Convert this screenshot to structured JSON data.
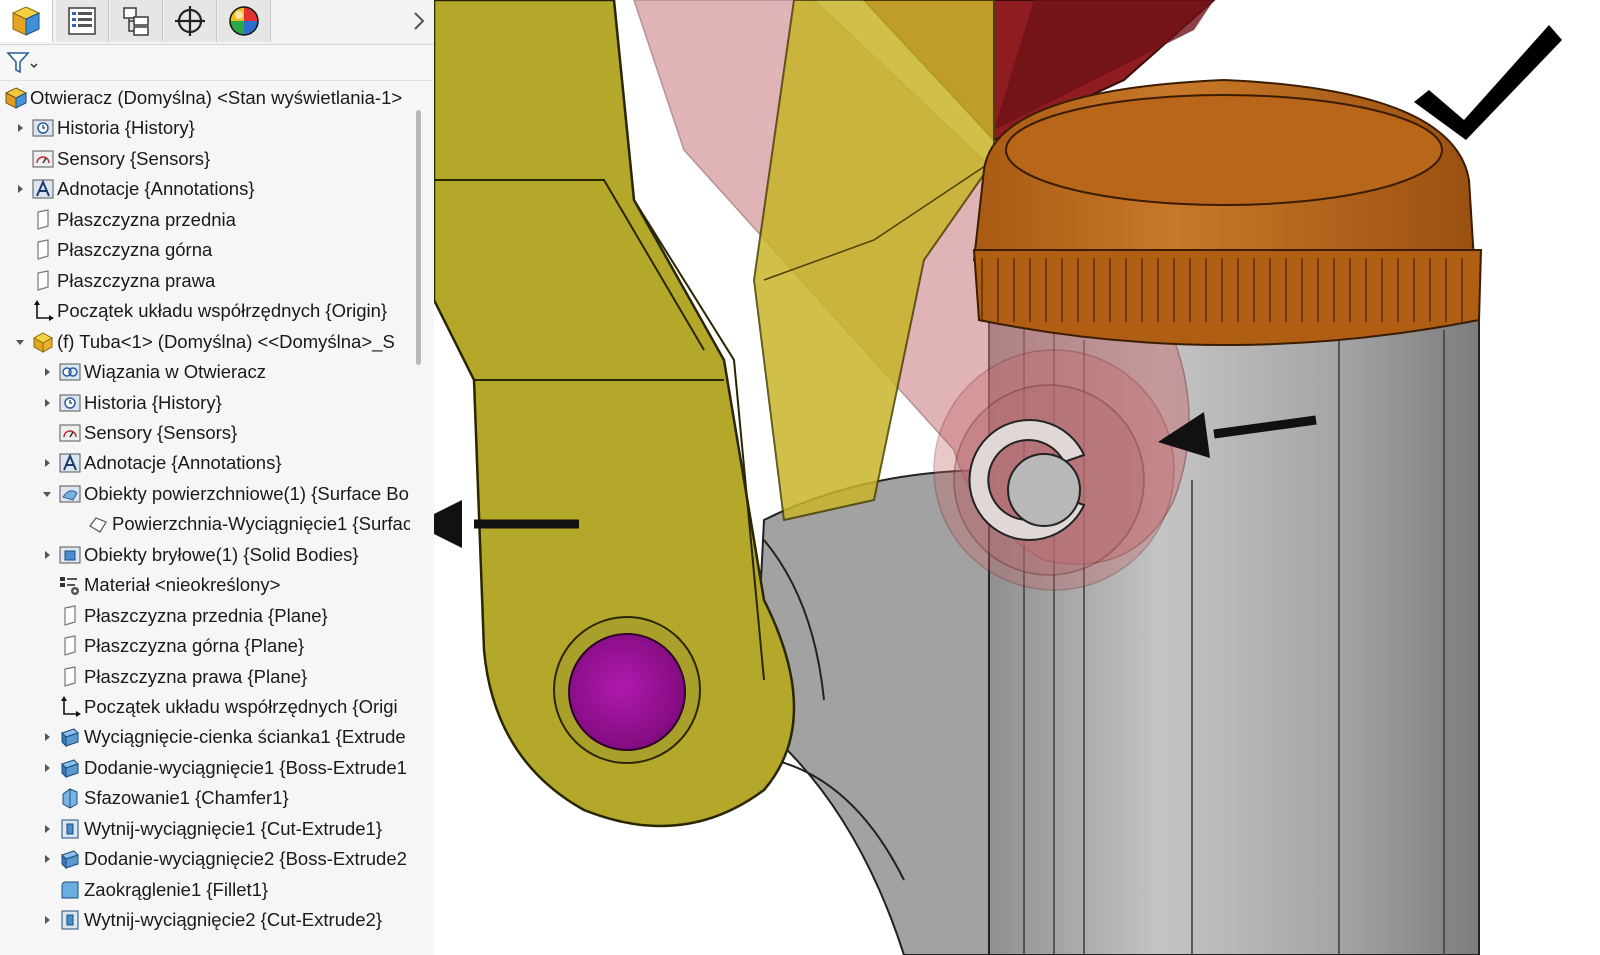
{
  "panel": {
    "tabs": [
      {
        "icon": "part-cube-icon"
      },
      {
        "icon": "property-manager-icon"
      },
      {
        "icon": "configuration-manager-icon"
      },
      {
        "icon": "dimxpert-crosshair-icon"
      },
      {
        "icon": "display-manager-sphere-icon"
      }
    ],
    "filter_icon": "filter-icon"
  },
  "tree": [
    {
      "label": "Otwieracz (Domyślna) <Stan wyświetlania-1>",
      "icon": "assembly-icon",
      "level": 0,
      "toggle": "none"
    },
    {
      "label": "Historia {History}",
      "icon": "history-icon",
      "level": 1,
      "toggle": "collapsed"
    },
    {
      "label": "Sensory {Sensors}",
      "icon": "sensor-icon",
      "level": 1,
      "toggle": "none"
    },
    {
      "label": "Adnotacje {Annotations}",
      "icon": "annotation-icon",
      "level": 1,
      "toggle": "collapsed"
    },
    {
      "label": "Płaszczyzna przednia",
      "icon": "plane-icon",
      "level": 1,
      "toggle": "none"
    },
    {
      "label": "Płaszczyzna górna",
      "icon": "plane-icon",
      "level": 1,
      "toggle": "none"
    },
    {
      "label": "Płaszczyzna prawa",
      "icon": "plane-icon",
      "level": 1,
      "toggle": "none"
    },
    {
      "label": "Początek układu współrzędnych {Origin}",
      "icon": "origin-icon",
      "level": 1,
      "toggle": "none"
    },
    {
      "label": "(f) Tuba<1> (Domyślna) <<Domyślna>_S",
      "icon": "part-icon",
      "level": 1,
      "toggle": "expanded"
    },
    {
      "label": "Wiązania w Otwieracz",
      "icon": "mates-icon",
      "level": 2,
      "toggle": "collapsed"
    },
    {
      "label": "Historia {History}",
      "icon": "history-icon",
      "level": 2,
      "toggle": "collapsed"
    },
    {
      "label": "Sensory {Sensors}",
      "icon": "sensor-icon",
      "level": 2,
      "toggle": "none"
    },
    {
      "label": "Adnotacje {Annotations}",
      "icon": "annotation-icon",
      "level": 2,
      "toggle": "collapsed"
    },
    {
      "label": "Obiekty powierzchniowe(1) {Surface Bo",
      "icon": "surface-bodies-icon",
      "level": 2,
      "toggle": "expanded"
    },
    {
      "label": "Powierzchnia-Wyciągnięcie1 {Surfac",
      "icon": "surface-extrude-icon",
      "level": 3,
      "toggle": "none"
    },
    {
      "label": "Obiekty bryłowe(1) {Solid Bodies}",
      "icon": "solid-bodies-icon",
      "level": 2,
      "toggle": "collapsed"
    },
    {
      "label": "Materiał <nieokreślony>",
      "icon": "material-icon",
      "level": 2,
      "toggle": "none"
    },
    {
      "label": "Płaszczyzna przednia {Plane}",
      "icon": "plane-icon",
      "level": 2,
      "toggle": "none"
    },
    {
      "label": "Płaszczyzna górna {Plane}",
      "icon": "plane-icon",
      "level": 2,
      "toggle": "none"
    },
    {
      "label": "Płaszczyzna prawa {Plane}",
      "icon": "plane-icon",
      "level": 2,
      "toggle": "none"
    },
    {
      "label": "Początek układu współrzędnych {Origi",
      "icon": "origin-icon",
      "level": 2,
      "toggle": "none"
    },
    {
      "label": "Wyciągnięcie-cienka ścianka1 {Extrude",
      "icon": "extrude-thin-icon",
      "level": 2,
      "toggle": "collapsed"
    },
    {
      "label": "Dodanie-wyciągnięcie1 {Boss-Extrude1",
      "icon": "boss-extrude-icon",
      "level": 2,
      "toggle": "collapsed"
    },
    {
      "label": "Sfazowanie1 {Chamfer1}",
      "icon": "chamfer-icon",
      "level": 2,
      "toggle": "none"
    },
    {
      "label": "Wytnij-wyciągnięcie1 {Cut-Extrude1}",
      "icon": "cut-extrude-icon",
      "level": 2,
      "toggle": "collapsed"
    },
    {
      "label": "Dodanie-wyciągnięcie2 {Boss-Extrude2",
      "icon": "boss-extrude-icon",
      "level": 2,
      "toggle": "collapsed"
    },
    {
      "label": "Zaokrąglenie1 {Fillet1}",
      "icon": "fillet-icon",
      "level": 2,
      "toggle": "none"
    },
    {
      "label": "Wytnij-wyciągnięcie2 {Cut-Extrude2}",
      "icon": "cut-extrude-icon",
      "level": 2,
      "toggle": "collapsed"
    }
  ],
  "viewport": {
    "confirm_icon": "checkmark-icon",
    "colors": {
      "arm": "#b8ac2c",
      "pin": "#a0109e",
      "cap": "#b86818",
      "tube": "#a8a8a8",
      "red_link": "#8e1c20"
    }
  }
}
